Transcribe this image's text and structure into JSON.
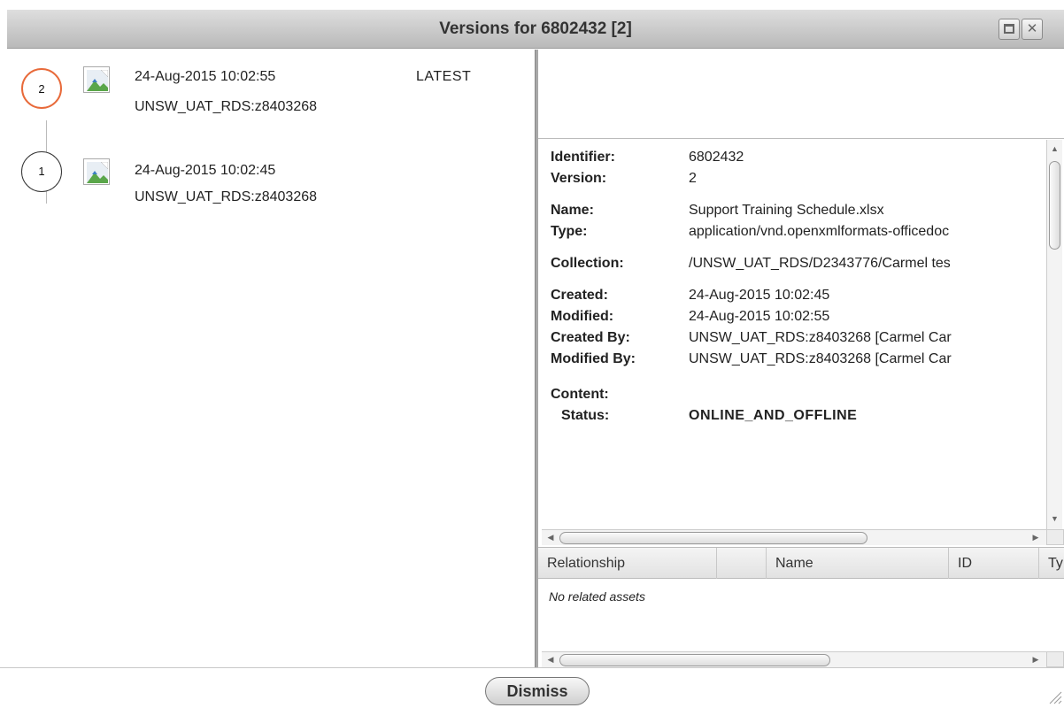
{
  "window": {
    "title": "Versions for 6802432 [2]",
    "maximize_icon": "maximize-icon",
    "close_icon": "close-icon",
    "close_glyph": "✕"
  },
  "versions": [
    {
      "number": "2",
      "timestamp": "24-Aug-2015 10:02:55",
      "user": "UNSW_UAT_RDS:z8403268",
      "badge": "LATEST",
      "highlight_color": "#e86a3a"
    },
    {
      "number": "1",
      "timestamp": "24-Aug-2015 10:02:45",
      "user": "UNSW_UAT_RDS:z8403268",
      "badge": ""
    }
  ],
  "details": {
    "identifier_label": "Identifier:",
    "identifier": "6802432",
    "version_label": "Version:",
    "version": "2",
    "name_label": "Name:",
    "name": "Support Training Schedule.xlsx",
    "type_label": "Type:",
    "type": "application/vnd.openxmlformats-officedoc",
    "collection_label": "Collection:",
    "collection": "/UNSW_UAT_RDS/D2343776/Carmel tes",
    "created_label": "Created:",
    "created": "24-Aug-2015 10:02:45",
    "modified_label": "Modified:",
    "modified": "24-Aug-2015 10:02:55",
    "created_by_label": "Created By:",
    "created_by": "UNSW_UAT_RDS:z8403268 [Carmel Car",
    "modified_by_label": "Modified By:",
    "modified_by": "UNSW_UAT_RDS:z8403268 [Carmel Car",
    "content_label": "Content:",
    "status_label": "Status:",
    "status": "ONLINE_AND_OFFLINE",
    "status_color": "#1a8a1a"
  },
  "relationships": {
    "columns": [
      "Relationship",
      "",
      "Name",
      "ID",
      "Ty"
    ],
    "empty_text": "No related assets"
  },
  "footer": {
    "dismiss_label": "Dismiss"
  }
}
